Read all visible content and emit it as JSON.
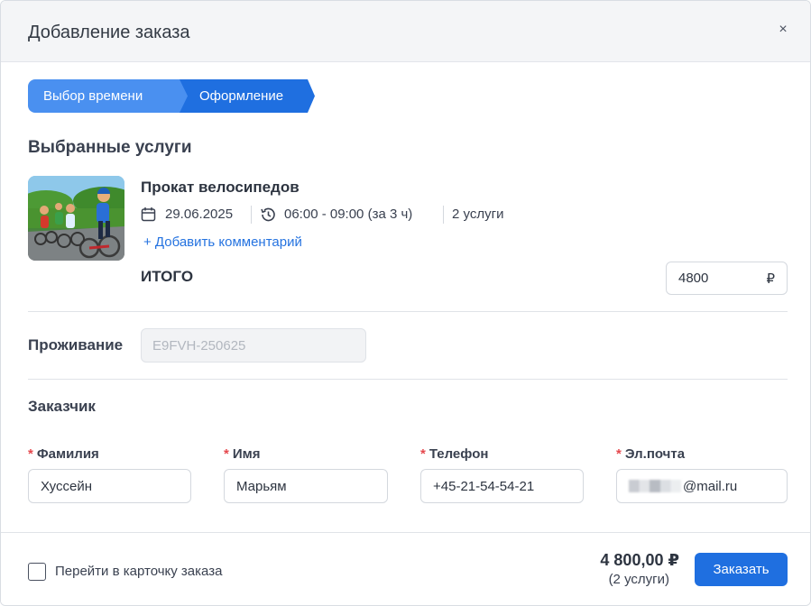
{
  "dialog": {
    "title": "Добавление заказа",
    "close_label": "×"
  },
  "steps": [
    {
      "label": "Выбор времени",
      "state": "done"
    },
    {
      "label": "Оформление",
      "state": "active"
    }
  ],
  "selected_services": {
    "title": "Выбранные услуги",
    "service": {
      "name": "Прокат велосипедов",
      "date": "29.06.2025",
      "time": "06:00 - 09:00 (за 3 ч)",
      "count": "2 услуги",
      "add_comment": "+ Добавить комментарий"
    },
    "total_label": "ИТОГО",
    "total_value": "4800",
    "currency": "₽"
  },
  "stay": {
    "label": "Проживание",
    "value": "E9FVH-250625"
  },
  "customer": {
    "title": "Заказчик",
    "required_mark": "*",
    "fields": [
      {
        "label": "Фамилия",
        "value": "Хуссейн"
      },
      {
        "label": "Имя",
        "value": "Марьям"
      },
      {
        "label": "Телефон",
        "value": "+45-21-54-54-21"
      },
      {
        "label": "Эл.почта",
        "value": "@mail.ru"
      }
    ]
  },
  "footer": {
    "checkbox_label": "Перейти в карточку заказа",
    "checkbox_checked": false,
    "total": "4 800,00 ₽",
    "count": "(2 услуги)",
    "submit_label": "Заказать"
  },
  "colors": {
    "accent": "#1f6fe0",
    "step_done": "#4a90f0",
    "link": "#2573e0",
    "required": "#e5484d"
  }
}
